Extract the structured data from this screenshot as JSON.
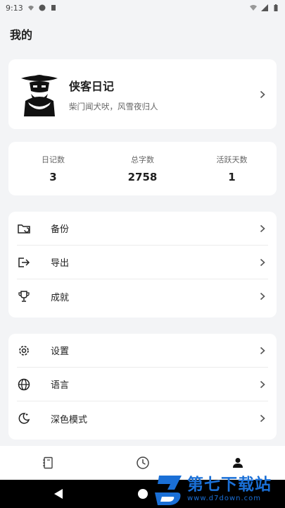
{
  "status": {
    "time": "9:13"
  },
  "page": {
    "title": "我的"
  },
  "profile": {
    "name": "侠客日记",
    "motto": "柴门闻犬吠，风雪夜归人"
  },
  "stats": [
    {
      "label": "日记数",
      "value": "3"
    },
    {
      "label": "总字数",
      "value": "2758"
    },
    {
      "label": "活跃天数",
      "value": "1"
    }
  ],
  "menu1": [
    {
      "label": "备份",
      "icon": "folder-sync-icon"
    },
    {
      "label": "导出",
      "icon": "export-icon"
    },
    {
      "label": "成就",
      "icon": "trophy-icon"
    }
  ],
  "menu2": [
    {
      "label": "设置",
      "icon": "gear-icon"
    },
    {
      "label": "语言",
      "icon": "globe-icon"
    },
    {
      "label": "深色模式",
      "icon": "moon-icon"
    }
  ],
  "tabs": [
    {
      "icon": "diary-book-icon",
      "active": false
    },
    {
      "icon": "clock-icon",
      "active": false
    },
    {
      "icon": "person-icon",
      "active": true
    }
  ],
  "watermark": {
    "brand": "第七下载站",
    "url": "www.d7down.com"
  },
  "colors": {
    "background": "#f3f4f6",
    "card": "#ffffff",
    "watermark": "#1a6fd6",
    "navbar": "#000000"
  }
}
